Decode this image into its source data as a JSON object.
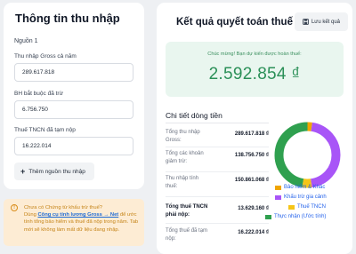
{
  "left": {
    "title": "Thông tin thu nhập",
    "source_label": "Nguồn 1",
    "gross_label": "Thu nhập Gross cả năm",
    "gross_value": "289.617.818",
    "insurance_label": "BH bắt buộc đã trừ",
    "insurance_value": "6.756.750",
    "tax_paid_label": "Thuế TNCN đã tạm nộp",
    "tax_paid_value": "16.222.014",
    "add_source_label": "Thêm nguồn thu nhập"
  },
  "warning": {
    "line1": "Chưa có Chứng từ khấu trừ thuế?",
    "pre_link": "Dùng ",
    "link": "Công cụ tính lương Gross → Net",
    "post_link": " để ước tính tổng bảo hiểm và thuế đã nộp trong năm. Tab mới sẽ không làm mất dữ liệu đang nhập."
  },
  "right": {
    "title": "Kết quả quyết toán thuế",
    "save_label": "Lưu kết quả",
    "result_message": "Chúc mừng! Bạn dự kiến được hoàn thuế:",
    "result_amount": "2.592.854 ₫",
    "detail_title": "Chi tiết dòng tiền",
    "rows": [
      {
        "label": "Tổng thu nhập Gross:",
        "value": "289.617.818 ₫"
      },
      {
        "label": "Tổng các khoản giảm trừ:",
        "value": "138.756.750 ₫"
      },
      {
        "label": "Thu nhập tính thuế:",
        "value": "150.861.068 ₫"
      },
      {
        "label": "Tổng thuế TNCN phải nộp:",
        "value": "13.629.160 ₫"
      },
      {
        "label": "Tổng thuế đã tạm nộp:",
        "value": "16.222.014 ₫"
      }
    ]
  },
  "chart_data": {
    "type": "pie",
    "style": "donut",
    "legend_position": "bottom",
    "categories": [
      "Bảo hiểm & Khác",
      "Khấu trừ gia cảnh",
      "Thuế TNCN",
      "Thực nhận (Ước tính)"
    ],
    "values": [
      6756750,
      132000000,
      13629160,
      137231908
    ],
    "colors": [
      "#f0a500",
      "#a855f7",
      "#f5c518",
      "#2fa04f"
    ]
  }
}
